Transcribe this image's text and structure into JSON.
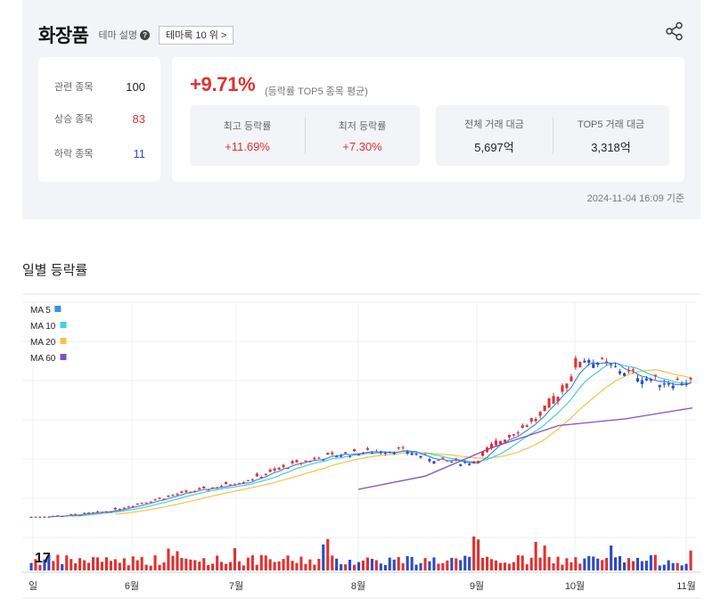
{
  "header": {
    "title": "화장품",
    "desc_label": "테마 설명",
    "help_icon": "question-circle-icon",
    "rank_button_label": "테마록 10 위 >",
    "share_icon": "share-icon"
  },
  "counts": {
    "related_label": "관련 종목",
    "related_value": "100",
    "up_label": "상승 종목",
    "up_value": "83",
    "down_label": "하락 종목",
    "down_value": "11"
  },
  "average": {
    "value": "+9.71%",
    "sub_label": "(등락률 TOP5 종목 평균)"
  },
  "stats": {
    "max_label": "최고 등락률",
    "max_value": "+11.69%",
    "min_label": "최저 등락률",
    "min_value": "+7.30%",
    "total_label": "전체 거래 대금",
    "total_value": "5,697억",
    "top5_label": "TOP5 거래 대금",
    "top5_value": "3,318억"
  },
  "timestamp": "2024-11-04 16:09 기준",
  "section_title": "일별 등락률",
  "colors": {
    "up": "#e03131",
    "down": "#2d4bbf",
    "ma5": "#3b8ee8",
    "ma10": "#4ec9e3",
    "ma20": "#f5c24a",
    "ma60": "#7b54c4"
  },
  "chart_data": {
    "type": "candlestick",
    "x_labels": [
      "일",
      "6월",
      "7월",
      "8월",
      "9월",
      "10월",
      "11월"
    ],
    "grid": true,
    "legend": [
      {
        "name": "MA 5",
        "color": "#3b8ee8"
      },
      {
        "name": "MA 10",
        "color": "#4ec9e3"
      },
      {
        "name": "MA 20",
        "color": "#f5c24a"
      },
      {
        "name": "MA 60",
        "color": "#7b54c4"
      }
    ],
    "legend_position": "top-left",
    "trend": [
      0.5,
      1.2,
      2.8,
      7.0,
      11.0,
      14.0,
      18.0,
      24.0,
      28.0,
      30.0,
      31.0,
      26.0,
      25.0,
      38.0,
      48.0,
      73.0,
      67.0,
      62.0,
      62.0
    ],
    "ma60": [
      13.0,
      19.0,
      32.0,
      42.0,
      45.0,
      50.0
    ]
  }
}
